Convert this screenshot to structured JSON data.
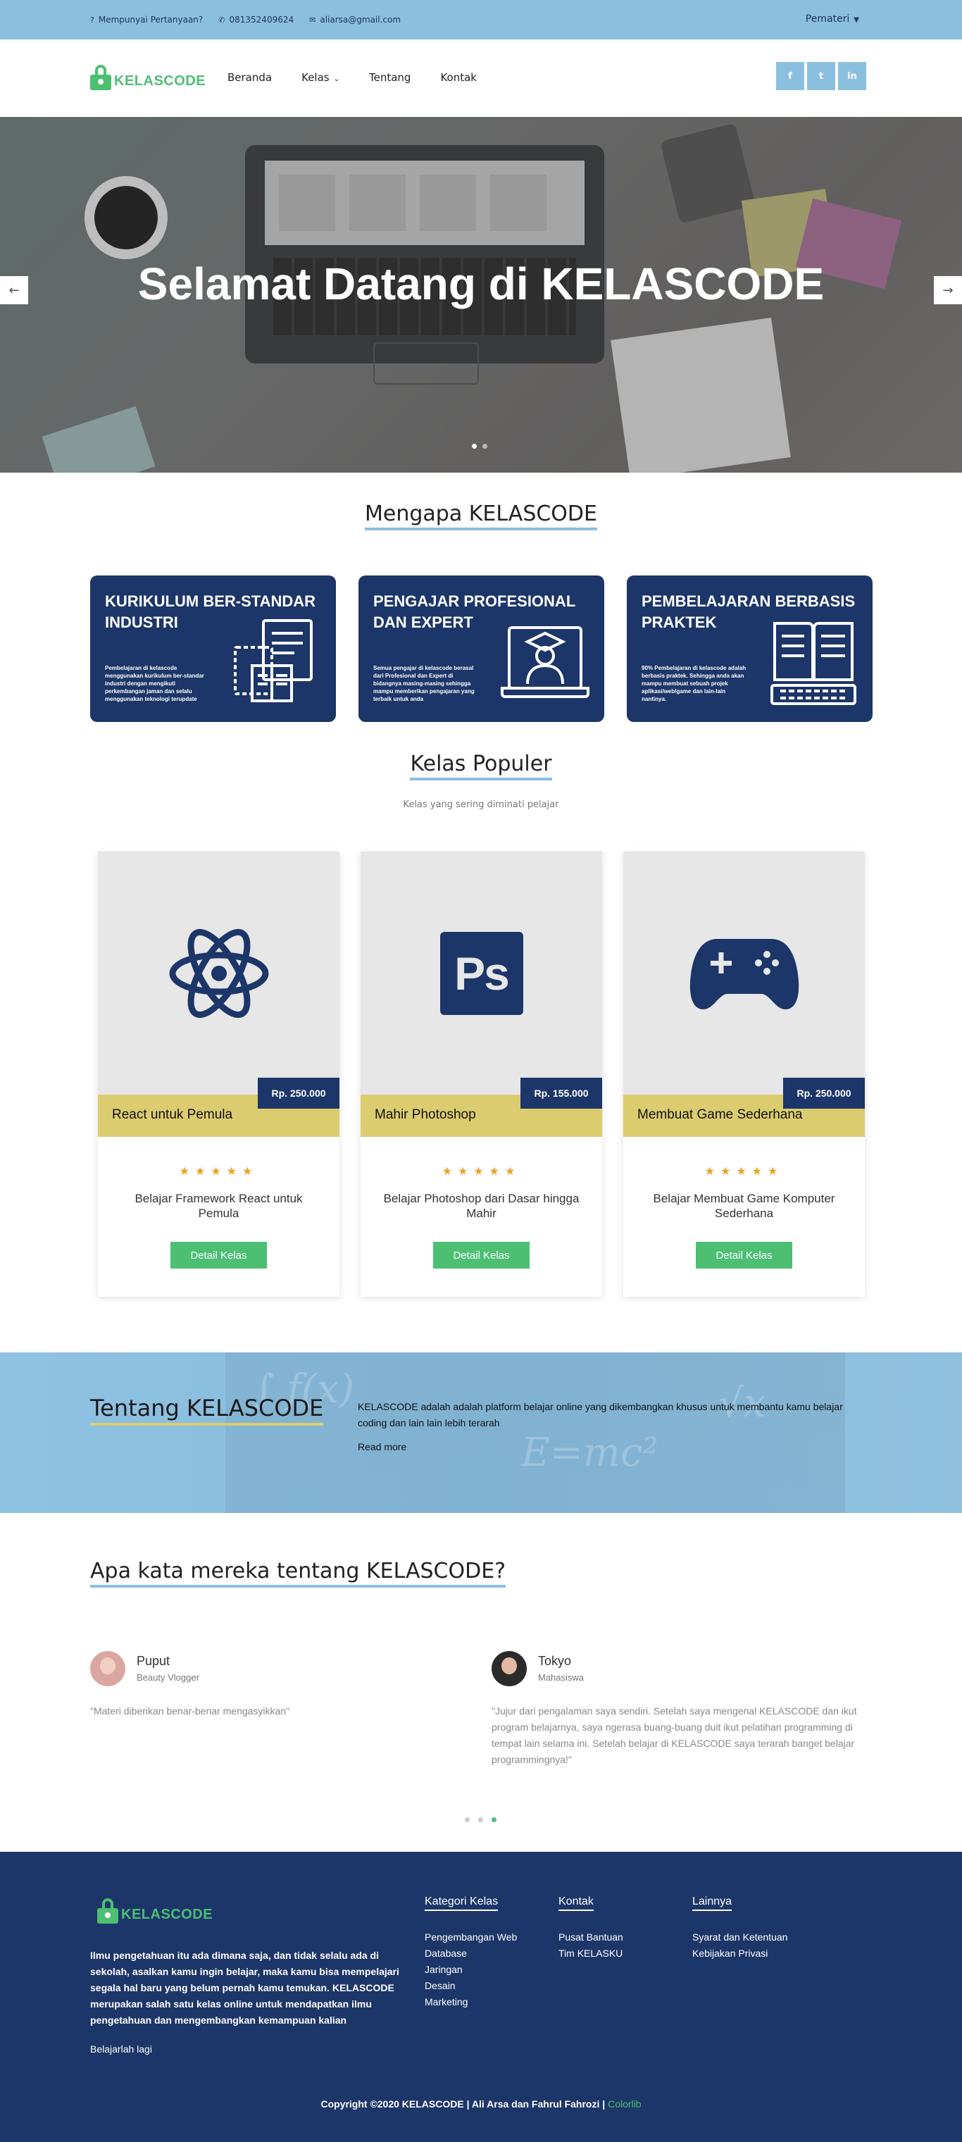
{
  "topbar": {
    "question": "Mempunyai Pertanyaan?",
    "phone": "081352409624",
    "email": "aliarsa@gmail.com",
    "pemateri": "Pemateri"
  },
  "brand": {
    "name": "KELASCODE",
    "color": "#4cbf73"
  },
  "nav": {
    "items": [
      "Beranda",
      "Kelas",
      "Tentang",
      "Kontak"
    ],
    "social": [
      "f",
      "t",
      "in"
    ]
  },
  "hero": {
    "title": "Selamat Datang di KELASCODE",
    "slides": 2,
    "active_slide": 1
  },
  "why": {
    "title": "Mengapa KELASCODE",
    "cards": [
      {
        "heading": "KURIKULUM BER-STANDAR INDUSTRI",
        "text": "Pembelajaran di kelascode menggunakan kurikulum ber-standar industri dengan mengikuti perkembangan jaman dan selalu menggunakan teknologi terupdate",
        "icon": "documents-icon"
      },
      {
        "heading": "PENGAJAR PROFESIONAL DAN EXPERT",
        "text": "Semua pengajar di kelascode berasal dari Profesional dan Expert di bidangnya masing-masing sehingga mampu memberikan pengajaran yang terbaik untuk anda",
        "icon": "graduate-laptop-icon"
      },
      {
        "heading": "PEMBELAJARAN BERBASIS PRAKTEK",
        "text": "90% Pembelajaran di kelascode adalah berbasis praktek. Sehingga anda akan mampu membuat sebuah projek aplikasi/web/game dan lain-lain nantinya.",
        "icon": "book-keyboard-icon"
      }
    ]
  },
  "popular": {
    "title": "Kelas Populer",
    "subtitle": "Kelas yang sering diminati pelajar",
    "courses": [
      {
        "name": "React untuk Pemula",
        "price": "Rp. 250.000",
        "desc": "Belajar Framework React untuk Pemula",
        "button": "Detail Kelas",
        "icon": "react-atom-icon",
        "rating": 5
      },
      {
        "name": "Mahir Photoshop",
        "price": "Rp. 155.000",
        "desc": "Belajar Photoshop dari Dasar hingga Mahir",
        "button": "Detail Kelas",
        "icon": "photoshop-icon",
        "icon_text": "Ps",
        "rating": 5
      },
      {
        "name": "Membuat Game Sederhana",
        "price": "Rp. 250.000",
        "desc": "Belajar Membuat Game Komputer Sederhana",
        "button": "Detail Kelas",
        "icon": "gamepad-icon",
        "rating": 5
      }
    ]
  },
  "about": {
    "title": "Tentang KELASCODE",
    "text": "KELASCODE adalah adalah platform belajar online yang dikembangkan khusus untuk membantu kamu belajar coding dan lain lain lebih terarah",
    "more": "Read more"
  },
  "testimonials": {
    "title": "Apa kata mereka tentang KELASCODE?",
    "items": [
      {
        "name": "Puput",
        "role": "Beauty Vlogger",
        "quote": "\"Materi diberikan benar-benar mengasyikkan\""
      },
      {
        "name": "Tokyo",
        "role": "Mahasiswa",
        "quote": "\"Jujur dari pengalaman saya sendiri. Setelah saya mengenal KELASCODE dan ikut program belajarnya, saya ngerasa buang-buang duit ikut pelatihan programming di tempat lain selama ini. Setelah belajar di KELASCODE saya terarah banget belajar programmingnya!\""
      }
    ],
    "dots": 3,
    "active_dot": 3
  },
  "footer": {
    "about": "Ilmu pengetahuan itu ada dimana saja, dan tidak selalu ada di sekolah, asalkan kamu ingin belajar, maka kamu bisa mempelajari segala hal baru yang belum pernah kamu temukan. KELASCODE merupakan salah satu kelas online untuk mendapatkan ilmu pengetahuan dan mengembangkan kemampuan kalian",
    "learn": "Belajarlah lagi",
    "columns": [
      {
        "title": "Kategori Kelas",
        "items": [
          "Pengembangan Web",
          "Database",
          "Jaringan",
          "Desain",
          "Marketing"
        ]
      },
      {
        "title": "Kontak",
        "items": [
          "Pusat Bantuan",
          "Tim KELASKU"
        ]
      },
      {
        "title": "Lainnya",
        "items": [
          "Syarat dan Ketentuan",
          "Kebijakan Privasi"
        ]
      }
    ],
    "copyright": "Copyright ©2020 KELASCODE | Ali Arsa dan Fahrul Fahrozi |",
    "credit": "Colorlib"
  }
}
